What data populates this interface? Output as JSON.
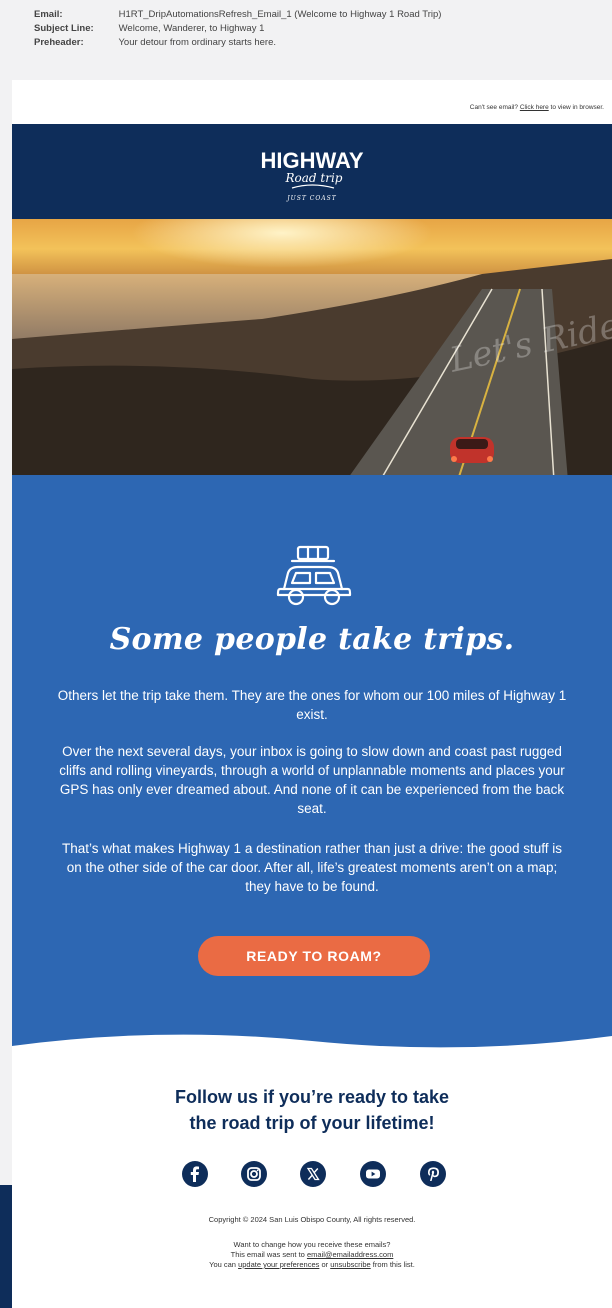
{
  "meta": {
    "rows": [
      {
        "label": "Email:",
        "value": "H1RT_DripAutomationsRefresh_Email_1 (Welcome to Highway 1 Road Trip)"
      },
      {
        "label": "Subject Line:",
        "value": "Welcome, Wanderer, to Highway 1"
      },
      {
        "label": "Preheader:",
        "value": "Your detour from ordinary starts here."
      }
    ]
  },
  "browser_link": {
    "prefix": "Can't see email? ",
    "link": "Click here",
    "suffix": " to view in browser."
  },
  "logo": {
    "top": "HIGHWAY",
    "script": "Road trip",
    "sub": "JUST COAST"
  },
  "hero": {
    "overlay_text": "Let's Ride"
  },
  "icon_names": {
    "car": "car-with-luggage-icon",
    "facebook": "facebook-icon",
    "instagram": "instagram-icon",
    "x": "x-icon",
    "youtube": "youtube-icon",
    "pinterest": "pinterest-icon"
  },
  "content": {
    "headline": "Some people take trips.",
    "p1": "Others let the trip take them. They are the ones for whom our 100 miles of Highway 1 exist.",
    "p2": "Over the next several days, your inbox is going to slow down and coast past rugged cliffs and rolling vineyards, through a world of unplannable moments and places your GPS has only ever dreamed about. And none of it can be experienced from the back seat.",
    "p3": "That’s what makes Highway 1 a destination rather than just a drive: the good stuff is on the other side of the car door. After all, life’s greatest moments aren’t on a map; they have to be found.",
    "cta": "READY TO ROAM?"
  },
  "footer": {
    "title_line1": "Follow us if  you’re ready to take",
    "title_line2": "the road trip of your lifetime!",
    "copyright": "Copyright © 2024 San Luis Obispo County, All rights reserved.",
    "change_line": "Want to change how you receive these emails?",
    "sent_prefix": "This email was sent to ",
    "sent_email": "email@emailaddress.com",
    "pref_prefix": "You can ",
    "pref_link": "update your preferences",
    "pref_mid": " or ",
    "unsub_link": "unsubscribe",
    "pref_suffix": " from this list."
  },
  "colors": {
    "navy": "#0e2d5a",
    "blue": "#2d67b3",
    "orange": "#ea6b44"
  }
}
